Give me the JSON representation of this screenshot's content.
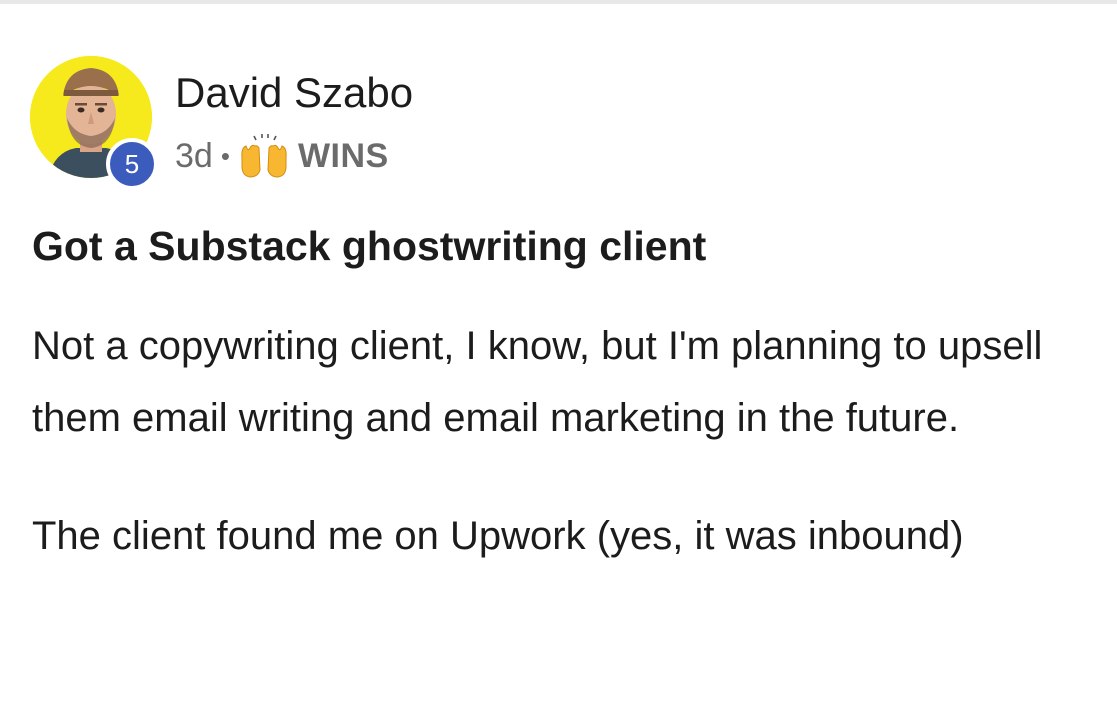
{
  "post": {
    "author": {
      "name": "David Szabo",
      "level": "5"
    },
    "meta": {
      "time": "3d",
      "separator": "•",
      "category_icon": "raising-hands-icon",
      "category": "WINS"
    },
    "title": "Got a Substack ghostwriting client",
    "body": [
      "Not a copywriting client, I know, but I'm planning to upsell them email writing and email marketing in the future.",
      "The client found me on Upwork (yes, it was inbound)"
    ]
  },
  "colors": {
    "avatar_bg": "#f6ea1c",
    "badge_bg": "#3b5bbd",
    "text": "#1c1c1c",
    "meta_text": "#6b6b6b",
    "divider": "#e8e8e8"
  }
}
